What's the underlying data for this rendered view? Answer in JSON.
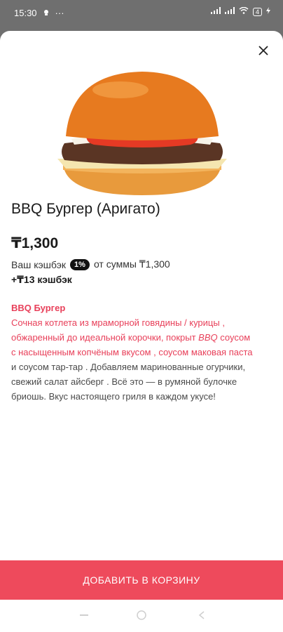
{
  "status_bar": {
    "time": "15:30",
    "dots": "···",
    "battery_level": "4"
  },
  "product": {
    "title": "BBQ Бургер (Аригато)",
    "price": "₸1,300",
    "cashback_label": "Ваш кэшбэк",
    "cashback_percent": "1%",
    "cashback_suffix": "от суммы ₸1,300",
    "cashback_amount": "+₸13 кэшбэк",
    "description": {
      "heading": "BBQ Бургер",
      "p1_red": "Сочная  котлета из мраморной говядины / курицы , обжаренный до идеальной корочки, покрыт ",
      "p1_italic": "BBQ",
      "p1_red2": " соусом с насыщенным копчёным вкусом , соусом маковая паста",
      "p2": " и соусом тар-тар . Добавляем маринованные огурчики, свежий салат айсберг . Всё это — в румяной булочке бриошь. Вкус настоящего гриля в каждом укусе!"
    }
  },
  "actions": {
    "add_to_cart": "ДОБАВИТЬ В КОРЗИНУ"
  },
  "icons": {
    "close": "close-icon",
    "back": "back-icon",
    "home": "home-icon",
    "recents": "recents-icon"
  },
  "colors": {
    "accent": "#ee4a5c",
    "description_red": "#e8405a"
  }
}
